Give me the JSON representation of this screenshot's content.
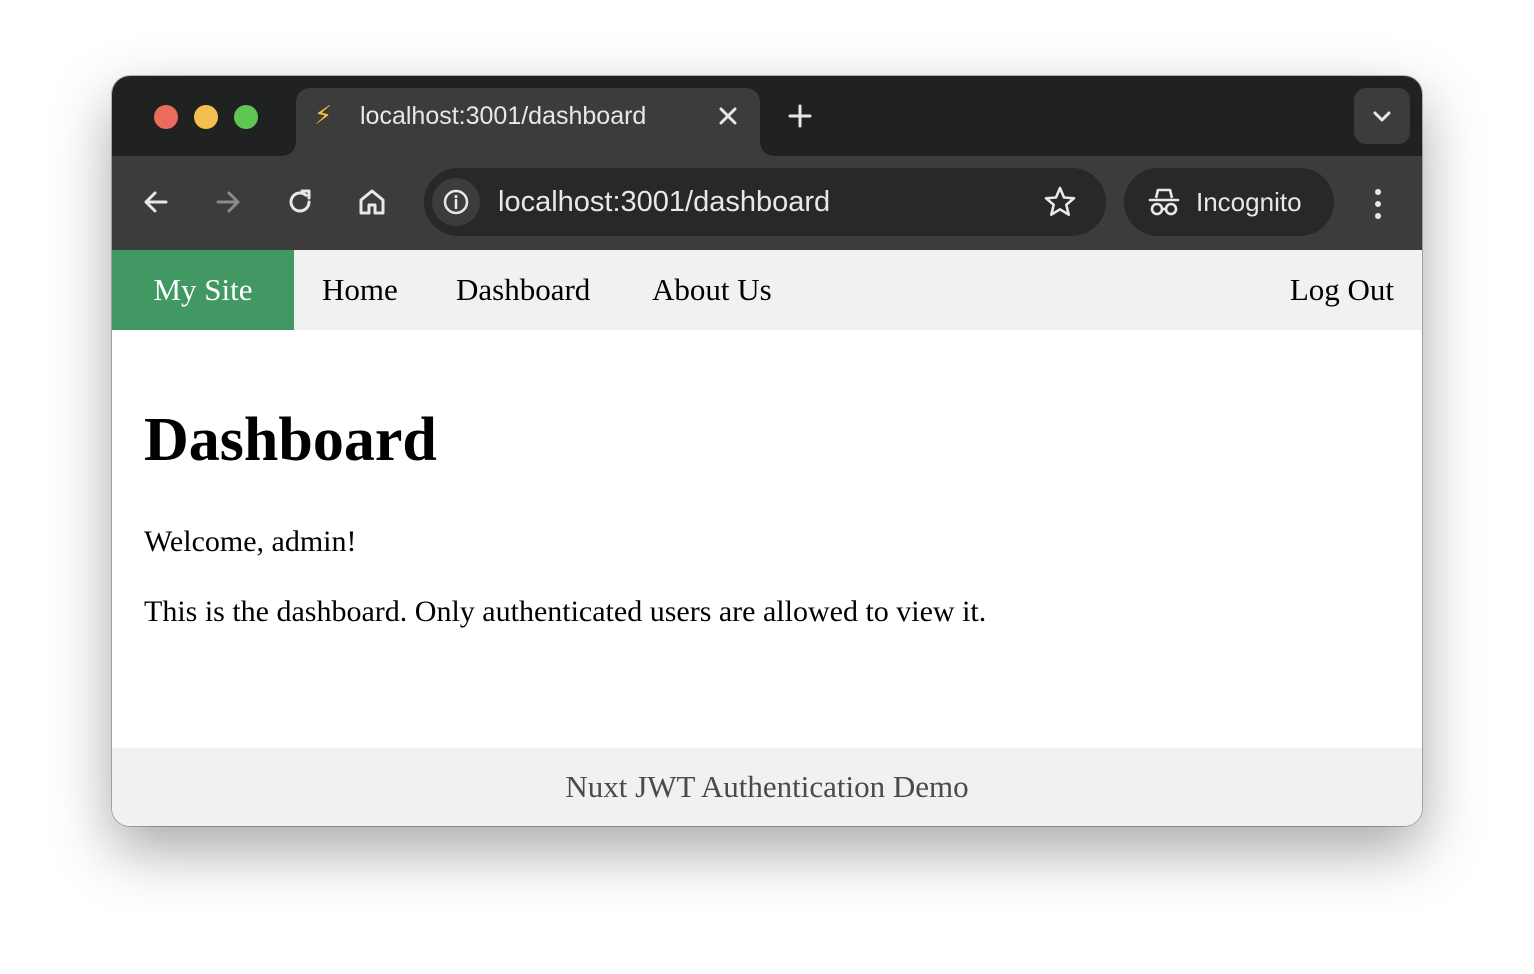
{
  "window": {
    "traffic_lights": [
      "close",
      "minimize",
      "zoom"
    ]
  },
  "tab": {
    "favicon": "⚡",
    "title": "localhost:3001/dashboard"
  },
  "toolbar": {
    "url": "localhost:3001/dashboard",
    "profile_label": "Incognito"
  },
  "icons": {
    "back": "arrow-left-icon",
    "forward": "arrow-right-icon",
    "reload": "reload-icon",
    "home": "home-icon",
    "site_info": "info-icon",
    "bookmark": "star-icon",
    "incognito": "incognito-icon",
    "menu": "kebab-menu-icon",
    "tab_close": "close-icon",
    "new_tab": "plus-icon",
    "tab_search": "chevron-down-icon"
  },
  "nav": {
    "brand": "My Site",
    "links": [
      "Home",
      "Dashboard",
      "About Us"
    ],
    "logout": "Log Out"
  },
  "main": {
    "title": "Dashboard",
    "welcome": "Welcome, admin!",
    "description": "This is the dashboard. Only authenticated users are allowed to view it."
  },
  "footer": {
    "text": "Nuxt JWT Authentication Demo"
  },
  "colors": {
    "brand_green": "#419863",
    "tabstrip_bg": "#202221",
    "toolbar_bg": "#3c3c3c",
    "nav_bg": "#f1f1f1"
  }
}
